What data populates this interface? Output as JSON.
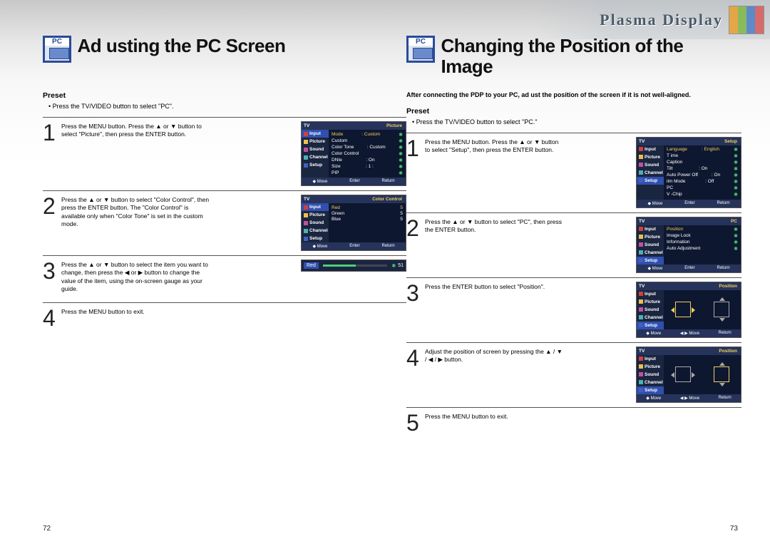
{
  "banner": {
    "title": "Plasma Display"
  },
  "left": {
    "pc_label": "PC",
    "title": "Ad usting the PC Screen",
    "preset_heading": "Preset",
    "preset_bullet": "•  Press the TV/VIDEO button to select \"PC\".",
    "steps": [
      {
        "num": "1",
        "text": "Press the MENU button. Press the ▲ or ▼ button to select \"Picture\", then press the ENTER button."
      },
      {
        "num": "2",
        "text": "Press the ▲ or ▼ button to select \"Color Control\", then press the ENTER button.\nThe \"Color Control\" is available only when \"Color Tone\" is set in the custom mode."
      },
      {
        "num": "3",
        "text": "Press the ▲ or ▼ button to select the item you want to change, then press the ◀ or ▶ button to change the value of the item, using the on-screen gauge as your guide."
      },
      {
        "num": "4",
        "text": "Press the MENU button to exit."
      }
    ],
    "osd1": {
      "cat": "Picture",
      "rows": [
        {
          "l": "Mode",
          "r": ": Custom",
          "hl": true
        },
        {
          "l": "Custom",
          "r": ""
        },
        {
          "l": "Color Tone",
          "r": ": Custom"
        },
        {
          "l": "Color Control",
          "r": ""
        },
        {
          "l": "DNIe",
          "r": ": On"
        },
        {
          "l": "Size",
          "r": ": 1 :"
        },
        {
          "l": "PIP",
          "r": ""
        }
      ]
    },
    "osd2": {
      "cat": "Color Control",
      "rows": [
        {
          "l": "Red",
          "r": "5",
          "hl": true
        },
        {
          "l": "Green",
          "r": "5"
        },
        {
          "l": "Blue",
          "r": "5"
        }
      ]
    },
    "osd3": {
      "tag": "Red",
      "value": "51"
    },
    "page_num": "72"
  },
  "right": {
    "pc_label": "PC",
    "title": "Changing the Position of the Image",
    "intro": "After connecting the PDP to your PC, ad ust the position of the screen if it is not well-aligned.",
    "preset_heading": "Preset",
    "preset_bullet": "•  Press the TV/VIDEO button to select \"PC.\"",
    "steps": [
      {
        "num": "1",
        "text": "Press the MENU button. Press the ▲ or ▼ button to select \"Setup\", then press the ENTER button."
      },
      {
        "num": "2",
        "text": "Press the ▲ or ▼ button to select \"PC\", then press the ENTER button."
      },
      {
        "num": "3",
        "text": "Press the ENTER button to select \"Position\"."
      },
      {
        "num": "4",
        "text": "Adjust the position of screen by pressing the ▲ / ▼ / ◀ / ▶ button."
      },
      {
        "num": "5",
        "text": "Press the MENU button to exit."
      }
    ],
    "osd1": {
      "cat": "Setup",
      "rows": [
        {
          "l": "Language",
          "r": ": English",
          "hl": true
        },
        {
          "l": "T ime",
          "r": ""
        },
        {
          "l": "Caption",
          "r": ""
        },
        {
          "l": "Tilt",
          "r": ": On"
        },
        {
          "l": "Auto Power Off",
          "r": ": On"
        },
        {
          "l": "ilm Mode",
          "r": ": Off"
        },
        {
          "l": "PC",
          "r": ""
        },
        {
          "l": "V -Chip",
          "r": ""
        }
      ]
    },
    "osd2": {
      "cat": "PC",
      "rows": [
        {
          "l": "Position",
          "r": "",
          "hl": true
        },
        {
          "l": "Image Lock",
          "r": ""
        },
        {
          "l": "Information",
          "r": ""
        },
        {
          "l": "Auto Adjustment",
          "r": ""
        }
      ]
    },
    "osd3": {
      "cat": "Position"
    },
    "osd4": {
      "cat": "Position"
    },
    "page_num": "73"
  },
  "osd_common": {
    "tv": "TV",
    "side": [
      "Input",
      "Picture",
      "Sound",
      "Channel",
      "Setup"
    ],
    "footer": [
      "◆ Move",
      "Enter",
      "Return"
    ],
    "footer_pos": [
      "◆ Move",
      "◀ ▶ Move",
      "Return"
    ]
  }
}
